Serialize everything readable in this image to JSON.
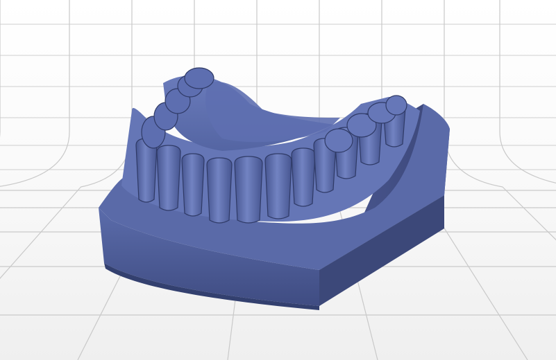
{
  "viewport": {
    "background_color": "#ffffff",
    "grid_color": "#c9c9c9",
    "floor_color": "#f3f3f3"
  },
  "model": {
    "icon": "dental-cast-model",
    "base_color": "#4f5f9a",
    "highlight_color": "#6f80bd",
    "shadow_color": "#3a467a"
  }
}
